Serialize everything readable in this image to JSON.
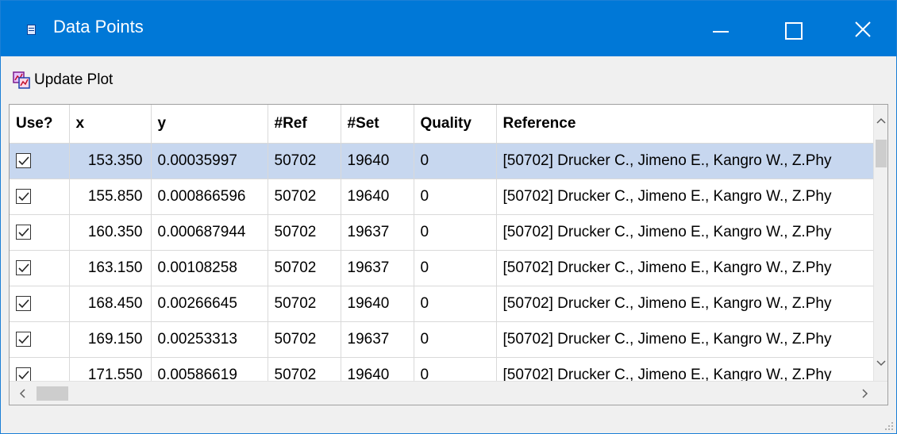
{
  "window": {
    "title": "Data Points",
    "accent_color": "#0078d7",
    "controls": [
      "minimize-icon",
      "maximize-icon",
      "close-icon"
    ]
  },
  "toolbar": {
    "update_plot_label": "Update Plot",
    "update_plot_icon": "plot-update-icon"
  },
  "table": {
    "columns": [
      "Use?",
      "x",
      "y",
      "#Ref",
      "#Set",
      "Quality",
      "Reference"
    ],
    "selected_row": 0,
    "rows": [
      {
        "use": true,
        "x": "153.350",
        "y": "0.00035997",
        "ref": "50702",
        "set": "19640",
        "quality": "0",
        "reference": "[50702] Drucker C., Jimeno E., Kangro W., Z.Phy"
      },
      {
        "use": true,
        "x": "155.850",
        "y": "0.000866596",
        "ref": "50702",
        "set": "19640",
        "quality": "0",
        "reference": "[50702] Drucker C., Jimeno E., Kangro W., Z.Phy"
      },
      {
        "use": true,
        "x": "160.350",
        "y": "0.000687944",
        "ref": "50702",
        "set": "19637",
        "quality": "0",
        "reference": "[50702] Drucker C., Jimeno E., Kangro W., Z.Phy"
      },
      {
        "use": true,
        "x": "163.150",
        "y": "0.00108258",
        "ref": "50702",
        "set": "19637",
        "quality": "0",
        "reference": "[50702] Drucker C., Jimeno E., Kangro W., Z.Phy"
      },
      {
        "use": true,
        "x": "168.450",
        "y": "0.00266645",
        "ref": "50702",
        "set": "19640",
        "quality": "0",
        "reference": "[50702] Drucker C., Jimeno E., Kangro W., Z.Phy"
      },
      {
        "use": true,
        "x": "169.150",
        "y": "0.00253313",
        "ref": "50702",
        "set": "19637",
        "quality": "0",
        "reference": "[50702] Drucker C., Jimeno E., Kangro W., Z.Phy"
      },
      {
        "use": true,
        "x": "171.550",
        "y": "0.00586619",
        "ref": "50702",
        "set": "19640",
        "quality": "0",
        "reference": "[50702] Drucker C., Jimeno E., Kangro W., Z.Phy"
      }
    ]
  }
}
